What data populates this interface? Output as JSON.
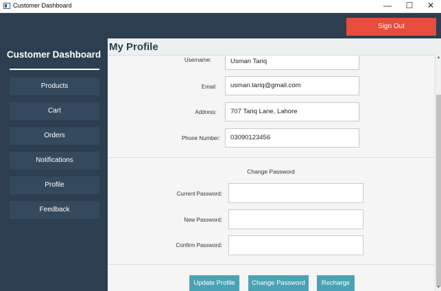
{
  "window": {
    "title": "Customer Dashboard",
    "minimize": "—",
    "maximize": "☐",
    "close": "✕"
  },
  "header": {
    "signout_label": "Sign Out"
  },
  "sidebar": {
    "title": "Customer Dashboard",
    "items": [
      {
        "label": "Products"
      },
      {
        "label": "Cart"
      },
      {
        "label": "Orders"
      },
      {
        "label": "Notifications"
      },
      {
        "label": "Profile"
      },
      {
        "label": "Feedback"
      }
    ]
  },
  "main": {
    "title": "My Profile",
    "profile": {
      "username_label": "Username:",
      "username_value": "Usman Tariq",
      "email_label": "Email:",
      "email_value": "usman.tariq@gmail.com",
      "address_label": "Address:",
      "address_value": "707 Tariq Lane, Lahore",
      "phone_label": "Phone Number:",
      "phone_value": "03090123456"
    },
    "password": {
      "section_title": "Change Password",
      "current_label": "Current Password:",
      "new_label": "New Password:",
      "confirm_label": "Confirm Password:"
    },
    "buttons": {
      "update_profile": "Update Profile",
      "change_password": "Change Password",
      "recharge": "Recharge"
    }
  },
  "scrollbar": {
    "up": "▲",
    "down": "▼"
  },
  "colors": {
    "sidebar_bg": "#2c3e50",
    "nav_button_bg": "#34495e",
    "signout_bg": "#e74c3c",
    "action_button_bg": "#4aa3b5",
    "content_bg": "#ecf0f1"
  }
}
